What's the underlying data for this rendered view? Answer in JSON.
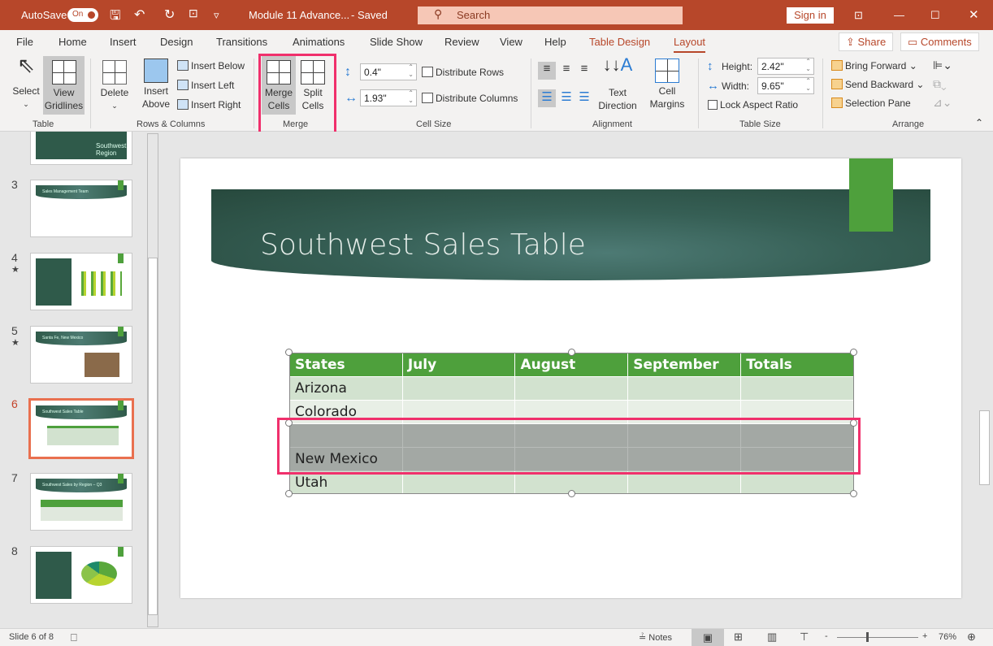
{
  "titlebar": {
    "autosave": "AutoSave",
    "toggle": "On",
    "doc_title": "Module 11 Advance...",
    "saved": "- Saved",
    "search": "Search",
    "signin": "Sign in"
  },
  "tabs": [
    "File",
    "Home",
    "Insert",
    "Design",
    "Transitions",
    "Animations",
    "Slide Show",
    "Review",
    "View",
    "Help",
    "Table Design",
    "Layout"
  ],
  "share": "Share",
  "comments": "Comments",
  "ribbon": {
    "table": {
      "select": "Select",
      "view_gridlines": "View Gridlines",
      "label": "Table"
    },
    "rows_cols": {
      "delete": "Delete",
      "insert_above": "Insert Above",
      "insert_below": "Insert Below",
      "insert_left": "Insert Left",
      "insert_right": "Insert Right",
      "label": "Rows & Columns"
    },
    "merge": {
      "merge_cells": "Merge Cells",
      "split_cells": "Split Cells",
      "label": "Merge"
    },
    "cell_size": {
      "height": "0.4\"",
      "width": "1.93\"",
      "distribute_rows": "Distribute Rows",
      "distribute_columns": "Distribute Columns",
      "label": "Cell Size"
    },
    "alignment": {
      "text_direction": "Text Direction",
      "cell_margins": "Cell Margins",
      "label": "Alignment"
    },
    "table_size": {
      "height_label": "Height:",
      "height": "2.42\"",
      "width_label": "Width:",
      "width": "9.65\"",
      "lock": "Lock Aspect Ratio",
      "label": "Table Size"
    },
    "arrange": {
      "bring_forward": "Bring Forward",
      "send_backward": "Send Backward",
      "selection_pane": "Selection Pane",
      "label": "Arrange"
    }
  },
  "thumbnails": [
    {
      "num": "",
      "title": "Southwest Region"
    },
    {
      "num": "3",
      "title": "Sales Management Team"
    },
    {
      "num": "4",
      "title": ""
    },
    {
      "num": "5",
      "title": "Santa Fe, New Mexico"
    },
    {
      "num": "6",
      "title": "Southwest Sales Table"
    },
    {
      "num": "7",
      "title": "Southwest Sales by Region – Q3"
    },
    {
      "num": "8",
      "title": ""
    }
  ],
  "slide": {
    "title": "Southwest Sales Table",
    "table": {
      "headers": [
        "States",
        "July",
        "August",
        "September",
        "Totals"
      ],
      "rows": [
        [
          "Arizona",
          "",
          "",
          "",
          ""
        ],
        [
          "Colorado",
          "",
          "",
          "",
          ""
        ],
        [
          "",
          "",
          "",
          "",
          ""
        ],
        [
          "New Mexico",
          "",
          "",
          "",
          ""
        ],
        [
          "Utah",
          "",
          "",
          "",
          ""
        ]
      ]
    }
  },
  "status": {
    "slide": "Slide 6 of 8",
    "notes": "Notes",
    "zoom": "76%"
  },
  "colors": {
    "accent": "#b7472a",
    "table_header": "#4ea03c",
    "highlight": "#f0306c"
  }
}
